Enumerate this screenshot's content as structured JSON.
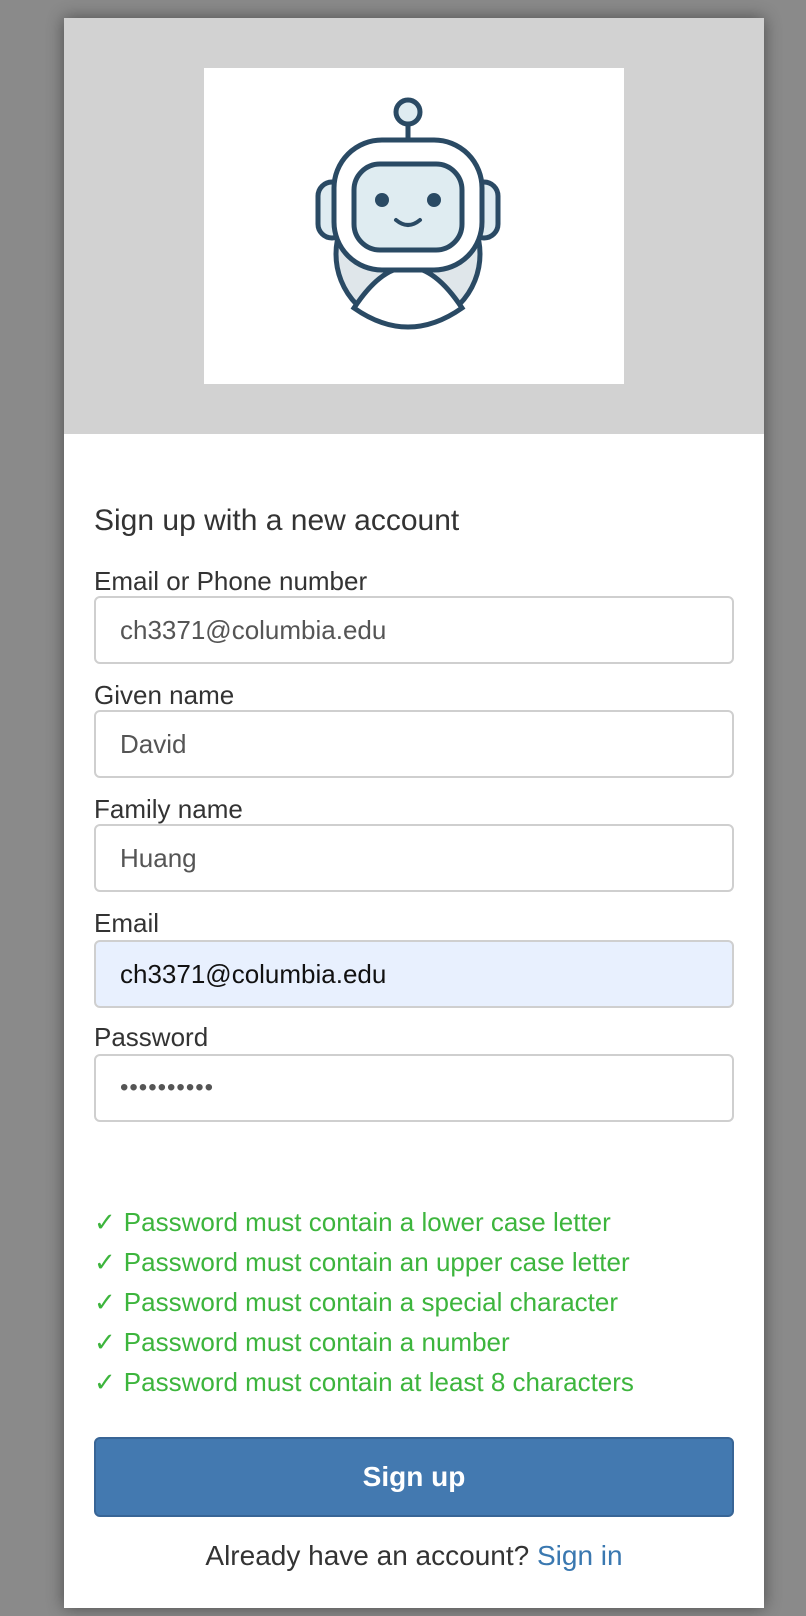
{
  "logo": {
    "icon": "robot-logo-icon",
    "colors": {
      "stroke": "#2a4a64",
      "fill": "#dfecf1"
    }
  },
  "form": {
    "heading": "Sign up with a new account",
    "fields": {
      "username": {
        "label": "Email or Phone number",
        "value": "ch3371@columbia.edu"
      },
      "given_name": {
        "label": "Given name",
        "value": "David"
      },
      "family_name": {
        "label": "Family name",
        "value": "Huang"
      },
      "email": {
        "label": "Email",
        "value": "ch3371@columbia.edu"
      },
      "password": {
        "label": "Password",
        "value": "••••••••••"
      }
    },
    "password_rules": [
      {
        "check": "✓",
        "text": "Password must contain a lower case letter"
      },
      {
        "check": "✓",
        "text": "Password must contain an upper case letter"
      },
      {
        "check": "✓",
        "text": "Password must contain a special character"
      },
      {
        "check": "✓",
        "text": "Password must contain a number"
      },
      {
        "check": "✓",
        "text": "Password must contain at least 8 characters"
      }
    ],
    "submit_label": "Sign up",
    "signin_prompt": "Already have an account?",
    "signin_link": "Sign in"
  },
  "colors": {
    "backdrop": "#8a8a8a",
    "banner": "#d2d2d2",
    "rule_ok": "#3db53d",
    "button": "#4379b0",
    "link": "#3a78b0",
    "autofill": "#e8f0fe"
  }
}
